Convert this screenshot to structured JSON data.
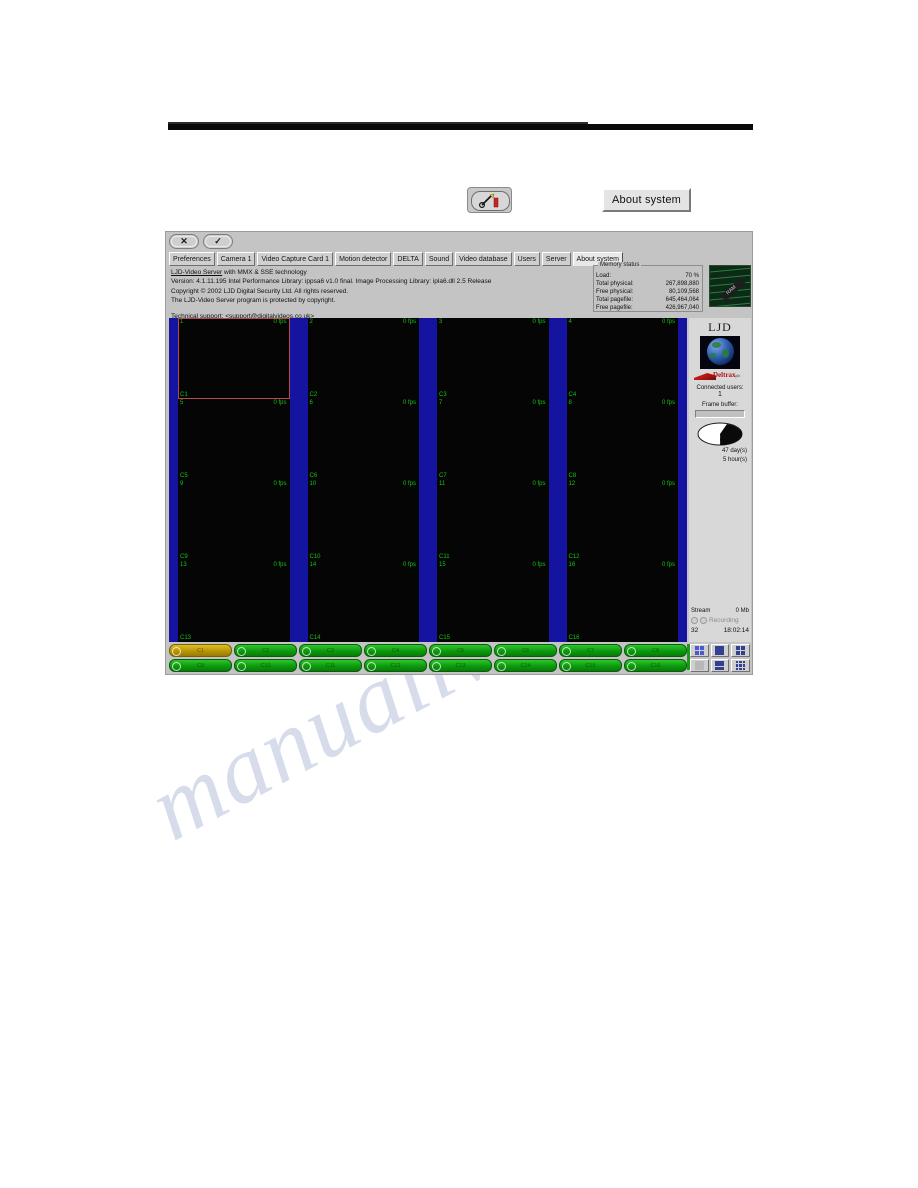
{
  "callouts": {
    "icon_button_name": "tools-icon",
    "about_button_label": "About system"
  },
  "window": {
    "commands": {
      "cancel_glyph": "✕",
      "apply_glyph": "✓"
    },
    "tabs": [
      {
        "label": "Preferences",
        "active": false
      },
      {
        "label": "Camera 1",
        "active": false
      },
      {
        "label": "Video Capture Card 1",
        "active": false
      },
      {
        "label": "Motion detector",
        "active": false
      },
      {
        "label": "DELTA",
        "active": false
      },
      {
        "label": "Sound",
        "active": false
      },
      {
        "label": "Video database",
        "active": false
      },
      {
        "label": "Users",
        "active": false
      },
      {
        "label": "Server",
        "active": false
      },
      {
        "label": "About system",
        "active": true
      }
    ],
    "about": {
      "product": "LJD-Video Server",
      "line1_rest": "  with MMX & SSE technology",
      "line2": "Version: 4.1.11.195      Intel Performance Library: ippsa6 v1.0 final.  Image Processing Library: iplа6.dll 2.5 Release",
      "line3": "Copyright © 2002 LJD Digital Security Ltd. All rights reserved.",
      "line4": "The LJD-Video Server program is protected by copyright.",
      "support": "Technical support: <support@digitalvideos.co.uk>"
    },
    "memory": {
      "legend": "Memory status",
      "rows": [
        {
          "label": "Load:",
          "value": "70 %"
        },
        {
          "label": "Total physical:",
          "value": "267,898,880"
        },
        {
          "label": "Free physical:",
          "value": "80,109,568"
        },
        {
          "label": "Total pagefile:",
          "value": "645,464,064"
        },
        {
          "label": "Free pagefile:",
          "value": "426,967,040"
        }
      ]
    },
    "side_panel": {
      "brand": "LJD",
      "vendor": "Deltrax",
      "vendor_suffix": "plc",
      "connected_users_label": "Connected users:",
      "connected_users_value": "1",
      "frame_buffer_label": "Frame buffer:",
      "uptime_days": "47 day(s)",
      "uptime_hours": "5 hour(s)",
      "stream_label": "Stream",
      "stream_value": "0 Mb",
      "recording_label": "Recording",
      "counter": "32",
      "clock": "18:02:14"
    },
    "grid": {
      "selected_index": 1,
      "cells": [
        {
          "num": "1",
          "fps": "0 fps",
          "cam": "C1"
        },
        {
          "num": "2",
          "fps": "0 fps",
          "cam": "C2"
        },
        {
          "num": "3",
          "fps": "0 fps",
          "cam": "C3"
        },
        {
          "num": "4",
          "fps": "0 fps",
          "cam": "C4"
        },
        {
          "num": "5",
          "fps": "0 fps",
          "cam": "C5"
        },
        {
          "num": "6",
          "fps": "0 fps",
          "cam": "C6"
        },
        {
          "num": "7",
          "fps": "0 fps",
          "cam": "C7"
        },
        {
          "num": "8",
          "fps": "0 fps",
          "cam": "C8"
        },
        {
          "num": "9",
          "fps": "0 fps",
          "cam": "C9"
        },
        {
          "num": "10",
          "fps": "0 fps",
          "cam": "C10"
        },
        {
          "num": "11",
          "fps": "0 fps",
          "cam": "C11"
        },
        {
          "num": "12",
          "fps": "0 fps",
          "cam": "C12"
        },
        {
          "num": "13",
          "fps": "0 fps",
          "cam": "C13"
        },
        {
          "num": "14",
          "fps": "0 fps",
          "cam": "C14"
        },
        {
          "num": "15",
          "fps": "0 fps",
          "cam": "C15"
        },
        {
          "num": "16",
          "fps": "0 fps",
          "cam": "C16"
        }
      ]
    },
    "status_bars": {
      "row1": [
        {
          "label": "C1",
          "active": true
        },
        {
          "label": "C2",
          "active": false
        },
        {
          "label": "C3",
          "active": false
        },
        {
          "label": "C4",
          "active": false
        },
        {
          "label": "C5",
          "active": false
        },
        {
          "label": "C6",
          "active": false
        },
        {
          "label": "C7",
          "active": false
        },
        {
          "label": "C8",
          "active": false
        }
      ],
      "row2": [
        {
          "label": "C9",
          "active": false
        },
        {
          "label": "C10",
          "active": false
        },
        {
          "label": "C11",
          "active": false
        },
        {
          "label": "C12",
          "active": false
        },
        {
          "label": "C13",
          "active": false
        },
        {
          "label": "C14",
          "active": false
        },
        {
          "label": "C15",
          "active": false
        },
        {
          "label": "C16",
          "active": false
        }
      ]
    },
    "layout_buttons": [
      {
        "name": "layout-quad",
        "selected": true
      },
      {
        "name": "layout-single",
        "selected": false
      },
      {
        "name": "layout-grid-9",
        "selected": false
      },
      {
        "name": "layout-blank",
        "selected": false
      },
      {
        "name": "layout-split-bottom",
        "selected": false
      },
      {
        "name": "layout-grid-16",
        "selected": false
      }
    ]
  },
  "watermark": {
    "text": "manualive.com",
    "text2": ".co"
  },
  "colors": {
    "window_face": "#c4c4c4",
    "video_backdrop": "#1414a0",
    "cell_black": "#050505",
    "osd_green": "#13c413",
    "selection_red": "#b8484c",
    "status_green": "#0c9a0c",
    "status_active": "#b89408"
  }
}
